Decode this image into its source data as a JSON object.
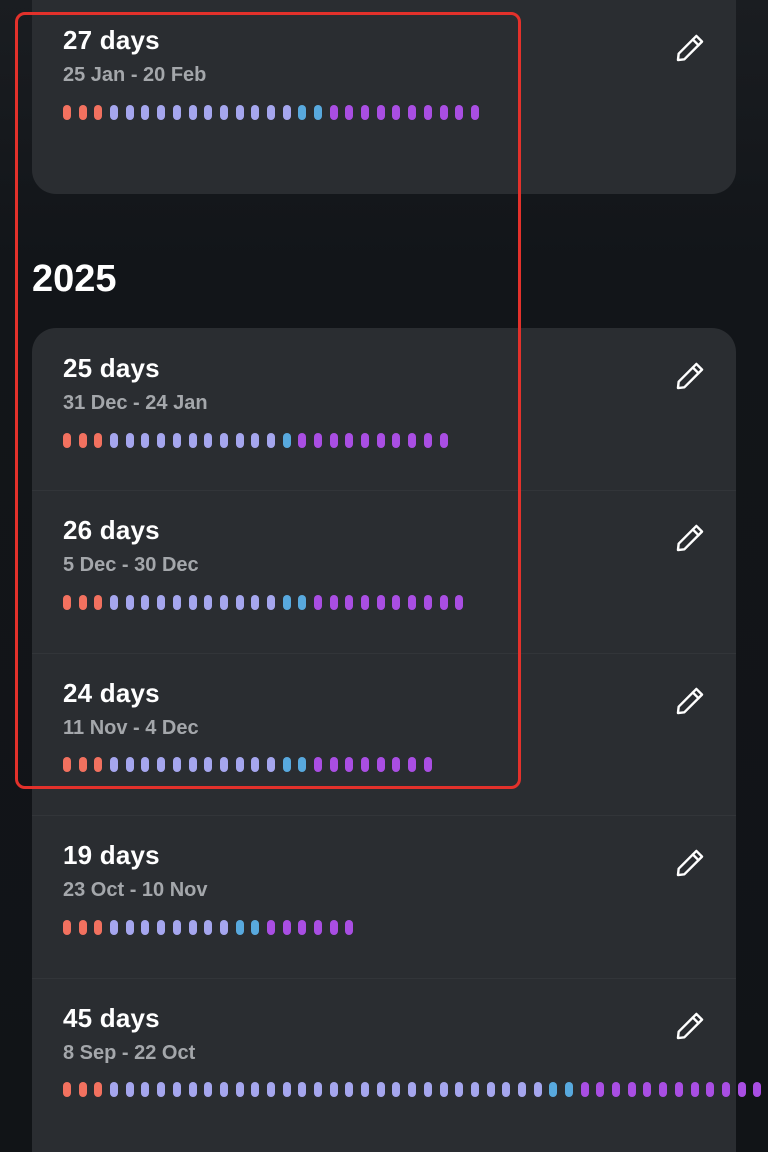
{
  "colors": {
    "period": "#f2715f",
    "follicular": "#a5a6ee",
    "fertile": "#58a9de",
    "luteal": "#a94ee3",
    "annotation": "#e3312b"
  },
  "icons": {
    "edit": "pencil-icon"
  },
  "top_cycle": {
    "days_label": "27 days",
    "range": "25 Jan - 20 Feb",
    "phases": {
      "period": 3,
      "follicular": 12,
      "fertile": 2,
      "luteal": 10
    }
  },
  "year_heading": "2025",
  "cycles": [
    {
      "days_label": "25 days",
      "range": "31 Dec - 24 Jan",
      "phases": {
        "period": 3,
        "follicular": 11,
        "fertile": 1,
        "luteal": 10
      }
    },
    {
      "days_label": "26 days",
      "range": "5 Dec - 30 Dec",
      "phases": {
        "period": 3,
        "follicular": 11,
        "fertile": 2,
        "luteal": 10
      }
    },
    {
      "days_label": "24 days",
      "range": "11 Nov - 4 Dec",
      "phases": {
        "period": 3,
        "follicular": 11,
        "fertile": 2,
        "luteal": 8
      }
    },
    {
      "days_label": "19 days",
      "range": "23 Oct - 10 Nov",
      "phases": {
        "period": 3,
        "follicular": 8,
        "fertile": 2,
        "luteal": 6
      }
    },
    {
      "days_label": "45 days",
      "range": "8 Sep - 22 Oct",
      "phases": {
        "period": 3,
        "follicular": 28,
        "fertile": 2,
        "luteal": 12
      }
    }
  ]
}
